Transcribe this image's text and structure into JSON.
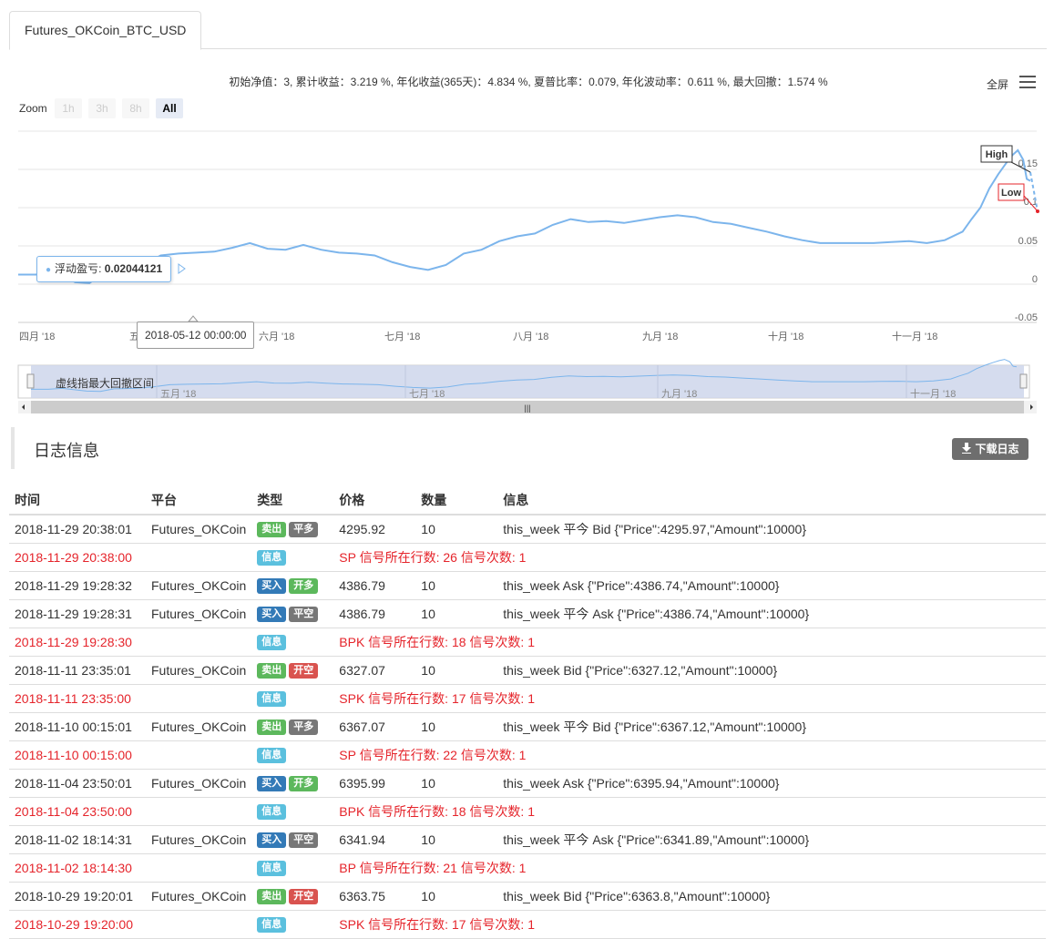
{
  "tab": {
    "label": "Futures_OKCoin_BTC_USD"
  },
  "stats_text": "初始净值：3, 累计收益：3.219 %, 年化收益(365天)：4.834 %, 夏普比率：0.079, 年化波动率：0.611 %, 最大回撤：1.574 %",
  "toolbar": {
    "fullscreen_label": "全屏"
  },
  "zoom": {
    "label": "Zoom",
    "buttons": [
      "1h",
      "3h",
      "8h",
      "All"
    ],
    "active": "All"
  },
  "chart_data": {
    "type": "line",
    "series": [
      {
        "name": "浮动盈亏"
      }
    ],
    "x_labels": [
      "四月 '18",
      "五月 '18",
      "六月 '18",
      "七月 '18",
      "八月 '18",
      "九月 '18",
      "十月 '18",
      "十一月 '18"
    ],
    "y_ticks": [
      "0.15",
      "0.1",
      "0.05",
      "0",
      "-0.05"
    ],
    "ylim": [
      -0.05,
      0.15
    ],
    "points": [
      [
        0,
        0.0
      ],
      [
        10,
        0.0
      ],
      [
        18,
        0.004
      ],
      [
        25,
        -0.002
      ],
      [
        32,
        -0.008
      ],
      [
        40,
        -0.009
      ],
      [
        48,
        0.002
      ],
      [
        60,
        0.004
      ],
      [
        70,
        0.01
      ],
      [
        80,
        0.02
      ],
      [
        90,
        0.022
      ],
      [
        100,
        0.023
      ],
      [
        110,
        0.024
      ],
      [
        120,
        0.028
      ],
      [
        130,
        0.033
      ],
      [
        140,
        0.027
      ],
      [
        150,
        0.026
      ],
      [
        160,
        0.031
      ],
      [
        170,
        0.026
      ],
      [
        180,
        0.023
      ],
      [
        190,
        0.022
      ],
      [
        200,
        0.02
      ],
      [
        210,
        0.013
      ],
      [
        220,
        0.008
      ],
      [
        230,
        0.005
      ],
      [
        240,
        0.01
      ],
      [
        250,
        0.022
      ],
      [
        260,
        0.026
      ],
      [
        270,
        0.035
      ],
      [
        280,
        0.04
      ],
      [
        290,
        0.043
      ],
      [
        300,
        0.052
      ],
      [
        310,
        0.058
      ],
      [
        320,
        0.055
      ],
      [
        330,
        0.056
      ],
      [
        340,
        0.054
      ],
      [
        350,
        0.057
      ],
      [
        360,
        0.06
      ],
      [
        370,
        0.062
      ],
      [
        380,
        0.06
      ],
      [
        390,
        0.055
      ],
      [
        400,
        0.053
      ],
      [
        410,
        0.049
      ],
      [
        420,
        0.045
      ],
      [
        430,
        0.04
      ],
      [
        440,
        0.036
      ],
      [
        450,
        0.033
      ],
      [
        460,
        0.033
      ],
      [
        470,
        0.033
      ],
      [
        480,
        0.033
      ],
      [
        490,
        0.034
      ],
      [
        500,
        0.035
      ],
      [
        510,
        0.033
      ],
      [
        520,
        0.036
      ],
      [
        530,
        0.045
      ],
      [
        535,
        0.058
      ],
      [
        540,
        0.07
      ],
      [
        545,
        0.09
      ],
      [
        550,
        0.105
      ],
      [
        555,
        0.118
      ],
      [
        558,
        0.125
      ],
      [
        561,
        0.13
      ],
      [
        564,
        0.12
      ],
      [
        566,
        0.1
      ],
      [
        568,
        0.098
      ]
    ],
    "x_range": [
      0,
      568
    ],
    "flags": [
      {
        "label": "High"
      },
      {
        "label": "Low"
      }
    ],
    "tooltip": {
      "series": "浮动盈亏",
      "value": "0.02044121",
      "date": "2018-05-12 00:00:00"
    },
    "navigator_labels": [
      "五月 '18",
      "七月 '18",
      "九月 '18",
      "十一月 '18"
    ],
    "navigator_annotation": "虚线指最大回撤区间"
  },
  "log": {
    "title": "日志信息",
    "download_label": "下载日志",
    "columns": [
      "时间",
      "平台",
      "类型",
      "价格",
      "数量",
      "信息"
    ],
    "rows": [
      {
        "time": "2018-11-29 20:38:01",
        "platform": "Futures_OKCoin",
        "badges": [
          {
            "text": "卖出",
            "color": "#5cb85c"
          },
          {
            "text": "平多",
            "color": "#777777"
          }
        ],
        "price": "4295.92",
        "amount": "10",
        "info": "this_week 平今 Bid {\"Price\":4295.97,\"Amount\":10000}",
        "signal": false
      },
      {
        "time": "2018-11-29 20:38:00",
        "platform": "",
        "badges": [
          {
            "text": "信息",
            "color": "#5bc0de"
          }
        ],
        "price": "",
        "amount": "",
        "info": "SP 信号所在行数: 26 信号次数: 1",
        "signal": true
      },
      {
        "time": "2018-11-29 19:28:32",
        "platform": "Futures_OKCoin",
        "badges": [
          {
            "text": "买入",
            "color": "#337ab7"
          },
          {
            "text": "开多",
            "color": "#5cb85c"
          }
        ],
        "price": "4386.79",
        "amount": "10",
        "info": "this_week Ask {\"Price\":4386.74,\"Amount\":10000}",
        "signal": false
      },
      {
        "time": "2018-11-29 19:28:31",
        "platform": "Futures_OKCoin",
        "badges": [
          {
            "text": "买入",
            "color": "#337ab7"
          },
          {
            "text": "平空",
            "color": "#777777"
          }
        ],
        "price": "4386.79",
        "amount": "10",
        "info": "this_week 平今 Ask {\"Price\":4386.74,\"Amount\":10000}",
        "signal": false
      },
      {
        "time": "2018-11-29 19:28:30",
        "platform": "",
        "badges": [
          {
            "text": "信息",
            "color": "#5bc0de"
          }
        ],
        "price": "",
        "amount": "",
        "info": "BPK 信号所在行数: 18 信号次数: 1",
        "signal": true
      },
      {
        "time": "2018-11-11 23:35:01",
        "platform": "Futures_OKCoin",
        "badges": [
          {
            "text": "卖出",
            "color": "#5cb85c"
          },
          {
            "text": "开空",
            "color": "#d9534f"
          }
        ],
        "price": "6327.07",
        "amount": "10",
        "info": "this_week Bid {\"Price\":6327.12,\"Amount\":10000}",
        "signal": false
      },
      {
        "time": "2018-11-11 23:35:00",
        "platform": "",
        "badges": [
          {
            "text": "信息",
            "color": "#5bc0de"
          }
        ],
        "price": "",
        "amount": "",
        "info": "SPK 信号所在行数: 17 信号次数: 1",
        "signal": true
      },
      {
        "time": "2018-11-10 00:15:01",
        "platform": "Futures_OKCoin",
        "badges": [
          {
            "text": "卖出",
            "color": "#5cb85c"
          },
          {
            "text": "平多",
            "color": "#777777"
          }
        ],
        "price": "6367.07",
        "amount": "10",
        "info": "this_week 平今 Bid {\"Price\":6367.12,\"Amount\":10000}",
        "signal": false
      },
      {
        "time": "2018-11-10 00:15:00",
        "platform": "",
        "badges": [
          {
            "text": "信息",
            "color": "#5bc0de"
          }
        ],
        "price": "",
        "amount": "",
        "info": "SP 信号所在行数: 22 信号次数: 1",
        "signal": true
      },
      {
        "time": "2018-11-04 23:50:01",
        "platform": "Futures_OKCoin",
        "badges": [
          {
            "text": "买入",
            "color": "#337ab7"
          },
          {
            "text": "开多",
            "color": "#5cb85c"
          }
        ],
        "price": "6395.99",
        "amount": "10",
        "info": "this_week Ask {\"Price\":6395.94,\"Amount\":10000}",
        "signal": false
      },
      {
        "time": "2018-11-04 23:50:00",
        "platform": "",
        "badges": [
          {
            "text": "信息",
            "color": "#5bc0de"
          }
        ],
        "price": "",
        "amount": "",
        "info": "BPK 信号所在行数: 18 信号次数: 1",
        "signal": true
      },
      {
        "time": "2018-11-02 18:14:31",
        "platform": "Futures_OKCoin",
        "badges": [
          {
            "text": "买入",
            "color": "#337ab7"
          },
          {
            "text": "平空",
            "color": "#777777"
          }
        ],
        "price": "6341.94",
        "amount": "10",
        "info": "this_week 平今 Ask {\"Price\":6341.89,\"Amount\":10000}",
        "signal": false
      },
      {
        "time": "2018-11-02 18:14:30",
        "platform": "",
        "badges": [
          {
            "text": "信息",
            "color": "#5bc0de"
          }
        ],
        "price": "",
        "amount": "",
        "info": "BP 信号所在行数: 21 信号次数: 1",
        "signal": true
      },
      {
        "time": "2018-10-29 19:20:01",
        "platform": "Futures_OKCoin",
        "badges": [
          {
            "text": "卖出",
            "color": "#5cb85c"
          },
          {
            "text": "开空",
            "color": "#d9534f"
          }
        ],
        "price": "6363.75",
        "amount": "10",
        "info": "this_week Bid {\"Price\":6363.8,\"Amount\":10000}",
        "signal": false
      },
      {
        "time": "2018-10-29 19:20:00",
        "platform": "",
        "badges": [
          {
            "text": "信息",
            "color": "#5bc0de"
          }
        ],
        "price": "",
        "amount": "",
        "info": "SPK 信号所在行数: 17 信号次数: 1",
        "signal": true
      }
    ]
  }
}
